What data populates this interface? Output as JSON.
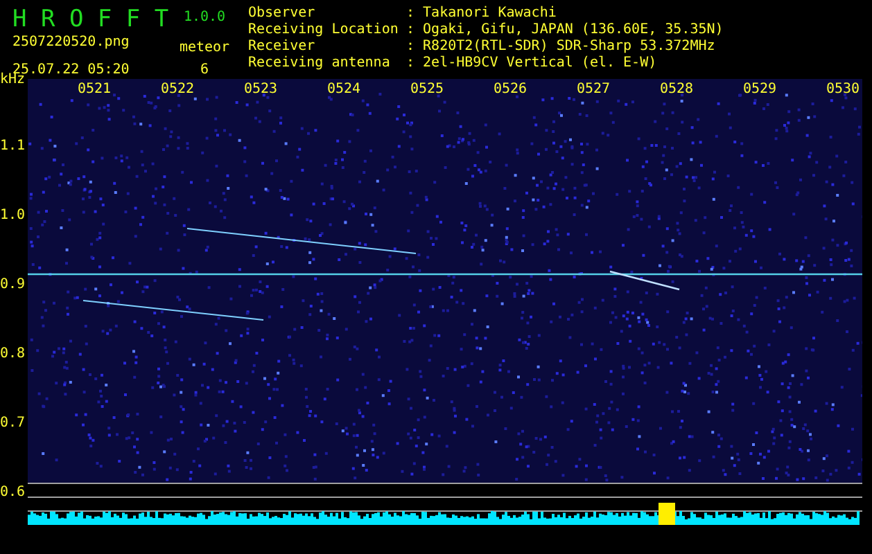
{
  "header": {
    "app_title": "H R O F F T",
    "version": "1.0.0",
    "file_name": "2507220520.png",
    "timestamp": "25.07.22 05:20",
    "meteor_label": "meteor",
    "meteor_count": "6"
  },
  "station_info": [
    {
      "label": "Observer",
      "value": ": Takanori Kawachi"
    },
    {
      "label": "Receiving Location",
      "value": ": Ogaki, Gifu, JAPAN (136.60E, 35.35N)"
    },
    {
      "label": "Receiver",
      "value": ": R820T2(RTL-SDR) SDR-Sharp 53.372MHz"
    },
    {
      "label": "Receiving antenna",
      "value": ": 2el-HB9CV Vertical (el. E-W)"
    }
  ],
  "spectrogram": {
    "frequency_unit": "kHz",
    "frequency_labels": [
      "1.1",
      "1.0",
      "0.9",
      "0.8",
      "0.7",
      "0.6"
    ],
    "time_labels": [
      "0521",
      "0522",
      "0523",
      "0524",
      "0525",
      "0526",
      "0527",
      "0528",
      "0529",
      "0530"
    ]
  }
}
